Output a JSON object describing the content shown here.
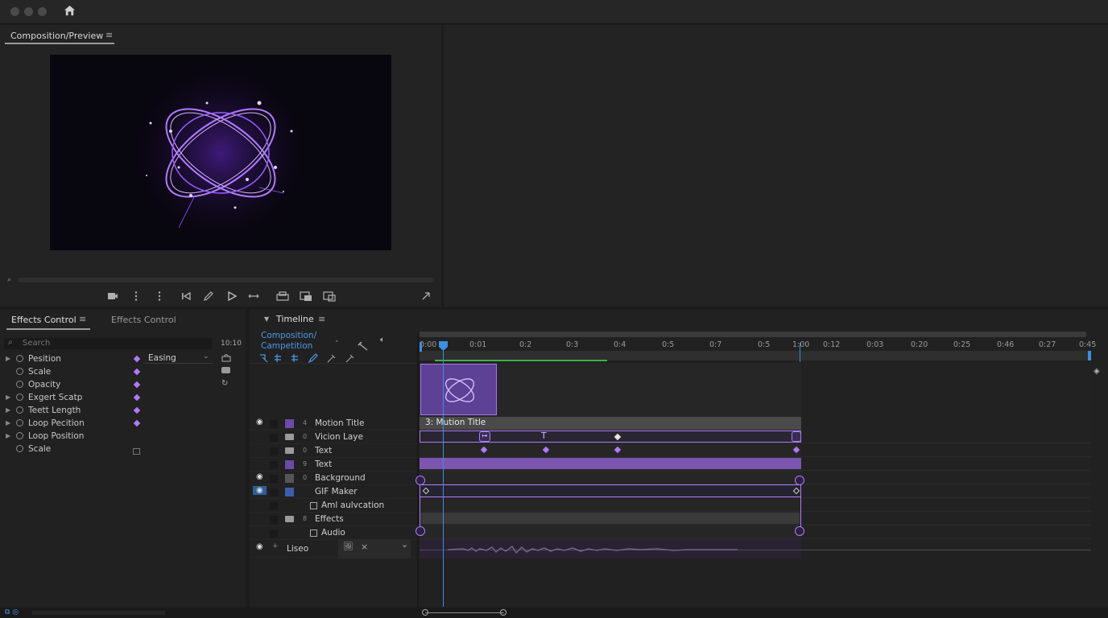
{
  "window": {
    "home_icon": "home-icon"
  },
  "preview": {
    "tab_label": "Composition/Preview",
    "menu_icon": "hamburger-icon",
    "controls": [
      "camera-icon",
      "more-vertical-icon",
      "more-vertical-icon",
      "skip-back-icon",
      "pen-icon",
      "play-icon",
      "loop-icon",
      "export-icon",
      "render-icon",
      "output-icon",
      "expand-icon"
    ]
  },
  "effects_panel": {
    "tabs": [
      "Effects Control",
      "Effects Control"
    ],
    "search_placeholder": "Search",
    "timecode": "10:10",
    "easing_value": "Easing",
    "properties": [
      {
        "label": "Pesition",
        "expand": true
      },
      {
        "label": "Scale",
        "expand": false
      },
      {
        "label": "Opacity",
        "expand": false
      },
      {
        "label": "Exgert Scatp",
        "expand": true
      },
      {
        "label": "Teett Length",
        "expand": true
      },
      {
        "label": "Loop Pecition",
        "expand": true
      },
      {
        "label": "Loop Position",
        "expand": true
      },
      {
        "label": "Scale",
        "expand": false
      }
    ]
  },
  "timeline": {
    "title": "Timeline",
    "comp_label_1": "Composition/",
    "comp_label_2": "Campetition",
    "ruler": [
      "0:00",
      "0:01",
      "0:2",
      "0:3",
      "0:4",
      "0:5",
      "0:7",
      "0:5",
      "1:00",
      "0:12",
      "0:03",
      "0:20",
      "0:25",
      "0:46",
      "0:27",
      "0:45"
    ],
    "layers": [
      {
        "name": "Motion Title",
        "num": "4"
      },
      {
        "name": "Vicion Laye",
        "num": "0"
      },
      {
        "name": "Text",
        "num": "0"
      },
      {
        "name": "Text",
        "num": "9"
      },
      {
        "name": "Background",
        "num": "0"
      },
      {
        "name": "GIF Maker",
        "num": ""
      },
      {
        "name": "Aml aulvcation",
        "num": ""
      },
      {
        "name": "Effects",
        "num": "8"
      },
      {
        "name": "Audio",
        "num": ""
      }
    ],
    "audio_track": "Liseo",
    "clip_label": "3: Mution Title"
  },
  "colors": {
    "accent": "#b278ff",
    "playhead": "#3d8fe0",
    "bar": "#7b56b0"
  }
}
